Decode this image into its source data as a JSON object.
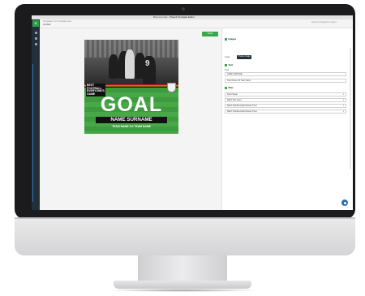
{
  "browser": {
    "title_prefix": "Bannersnack - ",
    "title_main": "Placeit Template Editor"
  },
  "header": {
    "breadcrumb": "Templates / 16 / Football Goal",
    "subtitle": "Football",
    "account": "Account | Support | Logout"
  },
  "leftnav": {
    "logo": "B"
  },
  "toolbar": {
    "save_label": "SAVE"
  },
  "poster": {
    "tagline": "BEST FOOTBALL EVERYONE'S GAME",
    "jersey_number": "9",
    "headline": "GOAL",
    "name": "NAME SURNAME",
    "teams": "TEAM NAME 2:0 TEAM NAME"
  },
  "panel": {
    "image_section": "Images",
    "image_label": "Image",
    "choose_button": "Choose Image",
    "text_section": "Text",
    "text_label_1": "Goal",
    "text_value_1": "NAME SURNAME",
    "text_value_2": "Team Name 2:0 Team Name",
    "misc_section": "Misc",
    "select_1": "Fixed Image",
    "select_2": "Match Title Label",
    "select_3": "Match Title/Description/Footer Timer",
    "select_4": "Match Title/Description/Footer Timer"
  },
  "colors": {
    "accent": "#35a94a",
    "nav": "#23303a",
    "help": "#2f6fb4"
  }
}
